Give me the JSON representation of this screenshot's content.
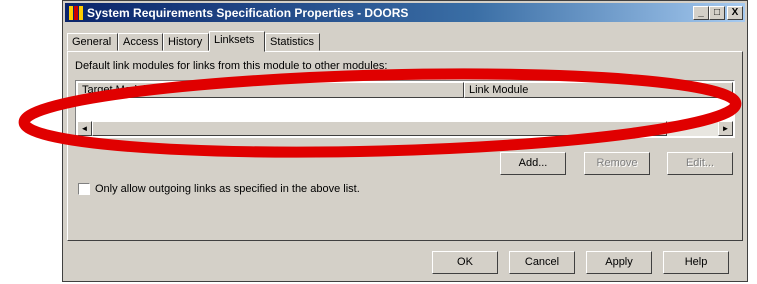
{
  "window": {
    "title": "System Requirements Specification Properties - DOORS",
    "controls": [
      "_",
      "□",
      "X"
    ]
  },
  "tabs": [
    {
      "label": "General",
      "active": false
    },
    {
      "label": "Access",
      "active": false
    },
    {
      "label": "History",
      "active": false
    },
    {
      "label": "Linksets",
      "active": true
    },
    {
      "label": "Statistics",
      "active": false
    }
  ],
  "linksets": {
    "description": "Default link modules for links from this module to other modules:",
    "columns": [
      "Target Module",
      "Link Module"
    ],
    "add_label": "Add...",
    "remove_label": "Remove",
    "edit_label": "Edit...",
    "checkbox_label": "Only allow outgoing links as specified in the above list.",
    "checkbox_checked": false
  },
  "footer": {
    "ok_label": "OK",
    "cancel_label": "Cancel",
    "apply_label": "Apply",
    "help_label": "Help"
  },
  "colors": {
    "annotation": "#e00000",
    "dialog_face": "#d4d0c8",
    "titlebar": "#0a246a"
  }
}
